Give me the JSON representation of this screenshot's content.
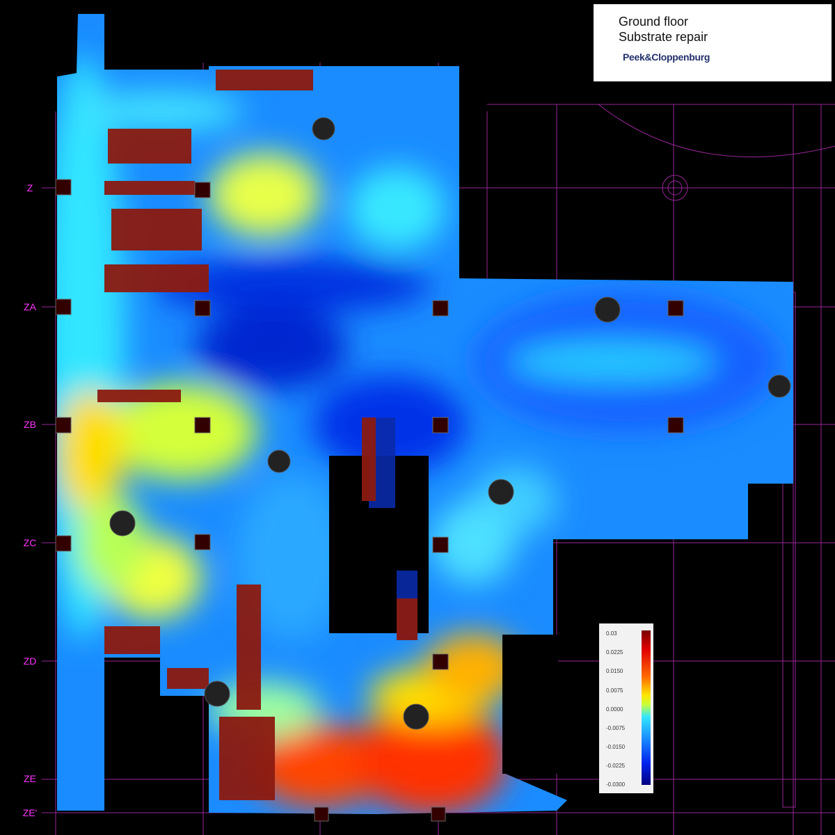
{
  "title": {
    "line1": "Ground floor",
    "line2": "Substrate repair",
    "logo_text": "Peek&Cloppenburg"
  },
  "grid_labels": [
    "Z",
    "ZA",
    "ZB",
    "ZC",
    "ZD",
    "ZE",
    "ZE'"
  ],
  "legend": {
    "labels": [
      "0.03",
      "0.0225",
      "0.0150",
      "0.0075",
      "0.0000",
      "-0.0075",
      "-0.0150",
      "-0.0225",
      "-0.0300"
    ],
    "colormap": [
      "#7a0000",
      "#e00000",
      "#ff6a00",
      "#ffe600",
      "#c8ff3a",
      "#33e6ff",
      "#1a8cff",
      "#0022ee",
      "#000080"
    ]
  },
  "colors": {
    "background": "#000000",
    "grid_line": "#cc33cc",
    "grid_label": "#ff33ff",
    "obstacle": "#8b1a10"
  }
}
